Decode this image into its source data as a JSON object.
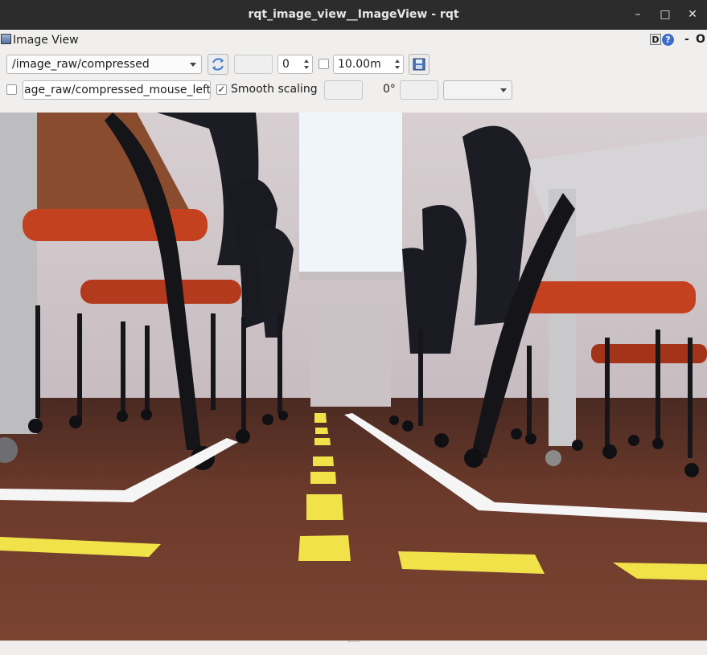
{
  "window": {
    "title": "rqt_image_view__ImageView - rqt",
    "controls": {
      "minimize": "–",
      "maximize": "□",
      "close": "✕"
    }
  },
  "plugin": {
    "title": "Image View",
    "d_label": "D",
    "help_label": "?",
    "min_label": "-",
    "close_label": "O"
  },
  "toolbar": {
    "topic": "/image_raw/compressed",
    "refresh_icon": "refresh-icon",
    "blank_field": "",
    "spin_value": "0",
    "max_range_checked": false,
    "max_range": "10.00m",
    "save_icon": "save-icon"
  },
  "row2": {
    "mouse_checked": false,
    "mouse_topic": "age_raw/compressed_mouse_left",
    "smooth_checked": true,
    "smooth_label": "Smooth scaling",
    "rotation": "0°",
    "rotation_combo": ""
  },
  "colors": {
    "titlebar": "#2c2c2c",
    "floor": "#6a3d2c",
    "tape_yellow": "#f2e24a",
    "tape_white": "#f5f5f5",
    "chair_seat": "#c4411f"
  }
}
